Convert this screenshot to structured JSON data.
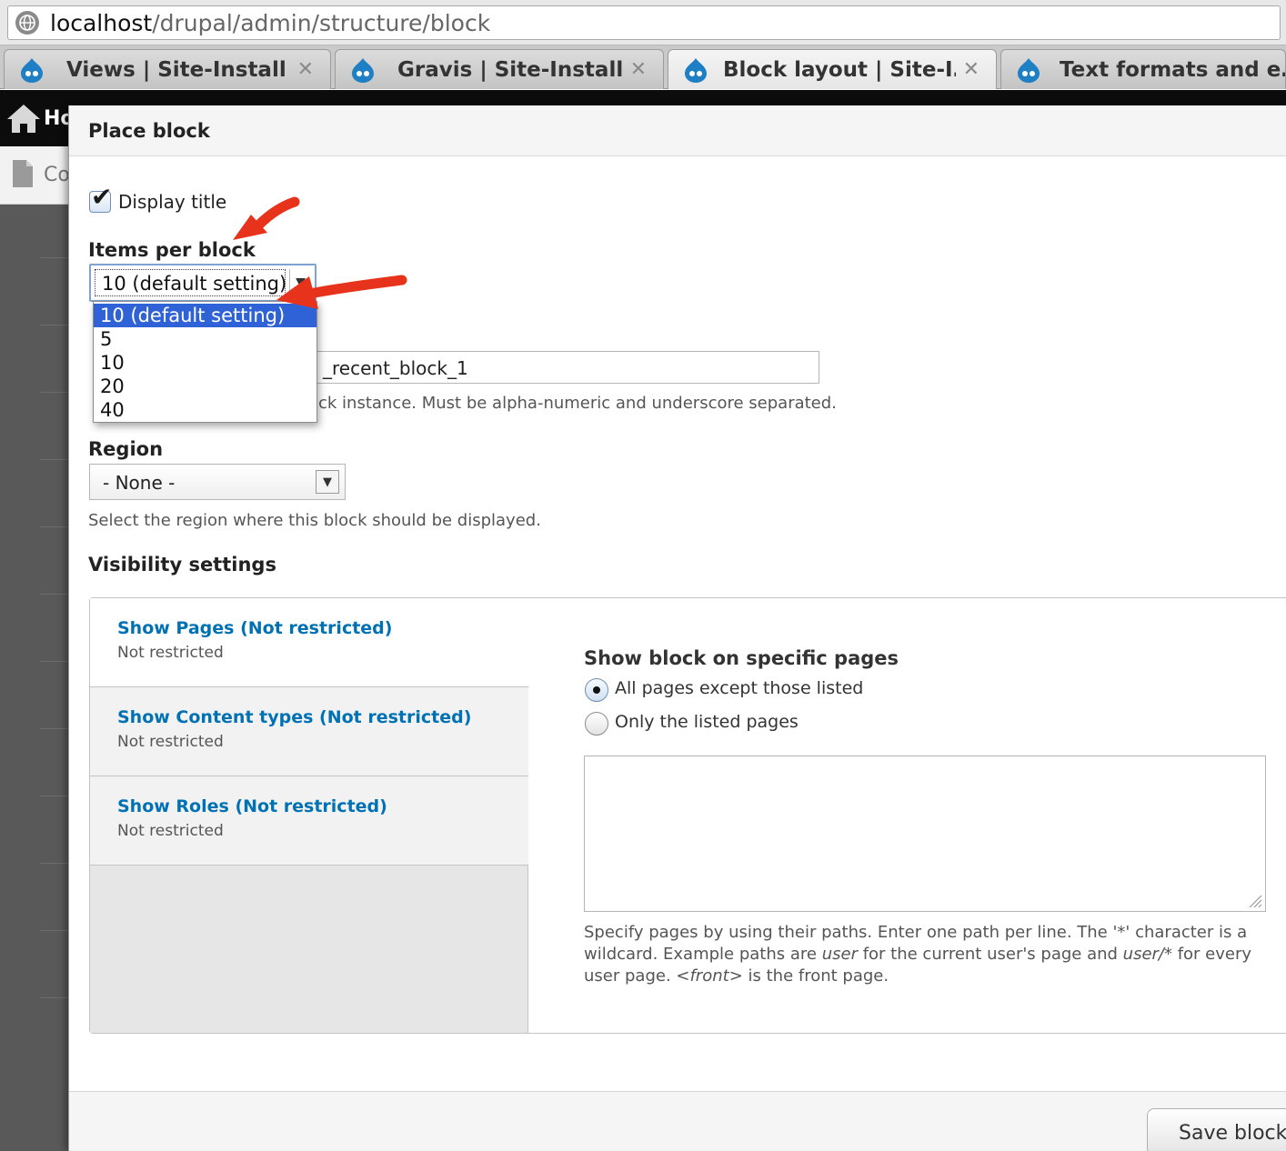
{
  "browser": {
    "url_host": "localhost",
    "url_path": "/drupal/admin/structure/block",
    "tabs": [
      {
        "label": "Views | Site-Install",
        "active": false
      },
      {
        "label": "Gravis | Site-Install",
        "active": false
      },
      {
        "label": "Block layout | Site-I…",
        "active": true
      },
      {
        "label": "Text formats and e…",
        "active": false
      }
    ],
    "tab_close_glyph": "✕"
  },
  "background": {
    "home_label": "Ho",
    "content_label": "Co"
  },
  "dialog": {
    "title": "Place block",
    "display_title": {
      "label": "Display title",
      "checked": true
    },
    "items_per_block": {
      "label": "Items per block",
      "selected": "10 (default setting)",
      "options": [
        "10 (default setting)",
        "5",
        "10",
        "20",
        "40"
      ]
    },
    "machine_name": {
      "value": "_recent_block_1",
      "description": "ck instance. Must be alpha-numeric and underscore separated."
    },
    "region": {
      "label": "Region",
      "selected": "- None -",
      "description": "Select the region where this block should be displayed."
    },
    "visibility": {
      "label": "Visibility settings",
      "tabs": [
        {
          "title": "Show Pages (Not restricted)",
          "summary": "Not restricted",
          "active": true
        },
        {
          "title": "Show Content types (Not restricted)",
          "summary": "Not restricted",
          "active": false
        },
        {
          "title": "Show Roles (Not restricted)",
          "summary": "Not restricted",
          "active": false
        }
      ],
      "pane": {
        "heading": "Show block on specific pages",
        "options": [
          {
            "label": "All pages except those listed",
            "checked": true
          },
          {
            "label": "Only the listed pages",
            "checked": false
          }
        ],
        "pages_value": "",
        "description": {
          "part1": "Specify pages by using their paths. Enter one path per line. The '*' character is a wildcard. Example paths are ",
          "em1": "user",
          "part2": " for the current user's page and ",
          "em2": "user/*",
          "part3": " for every user page. ",
          "em3": "<front>",
          "part4": " is the front page."
        }
      }
    },
    "save_label": "Save block"
  },
  "colors": {
    "link": "#0071b3",
    "selected_option": "#2f62d6",
    "annotation_arrow": "#e8331c"
  }
}
